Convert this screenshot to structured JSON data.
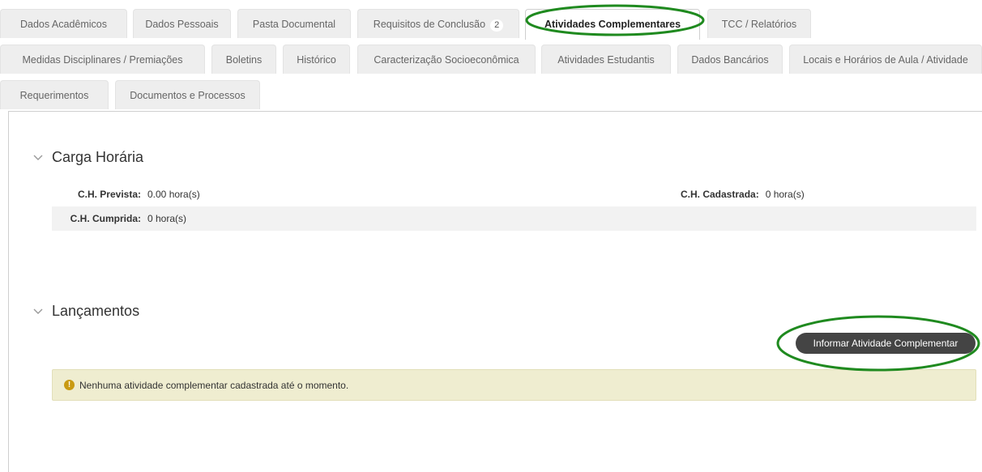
{
  "tabs": {
    "row1": [
      {
        "label": "Dados Acadêmicos"
      },
      {
        "label": "Dados Pessoais"
      },
      {
        "label": "Pasta Documental"
      },
      {
        "label": "Requisitos de Conclusão",
        "count": "2"
      },
      {
        "label": "Atividades Complementares",
        "active": true
      },
      {
        "label": "TCC / Relatórios"
      }
    ],
    "row2": [
      {
        "label": "Medidas Disciplinares / Premiações"
      },
      {
        "label": "Boletins"
      },
      {
        "label": "Histórico"
      },
      {
        "label": "Caracterização Socioeconômica"
      },
      {
        "label": "Atividades Estudantis"
      },
      {
        "label": "Dados Bancários"
      },
      {
        "label": "Locais e Horários de Aula / Atividade"
      }
    ],
    "row3": [
      {
        "label": "Requerimentos"
      },
      {
        "label": "Documentos e Processos"
      }
    ]
  },
  "carga_horaria": {
    "title": "Carga Horária",
    "prevista_label": "C.H. Prevista:",
    "prevista_value": "0.00 hora(s)",
    "cadastrada_label": "C.H. Cadastrada:",
    "cadastrada_value": "0 hora(s)",
    "cumprida_label": "C.H. Cumprida:",
    "cumprida_value": "0 hora(s)"
  },
  "lancamentos": {
    "title": "Lançamentos",
    "button_label": "Informar Atividade Complementar",
    "notice_text": "Nenhuma atividade complementar cadastrada até o momento."
  },
  "colors": {
    "highlight": "#1f8a1f",
    "button_bg": "#444444",
    "notice_bg": "#efedd0",
    "warn_icon": "#c99a12"
  },
  "icons": {
    "section_toggle": "chevron-down-icon",
    "notice": "exclamation-circle-icon"
  }
}
